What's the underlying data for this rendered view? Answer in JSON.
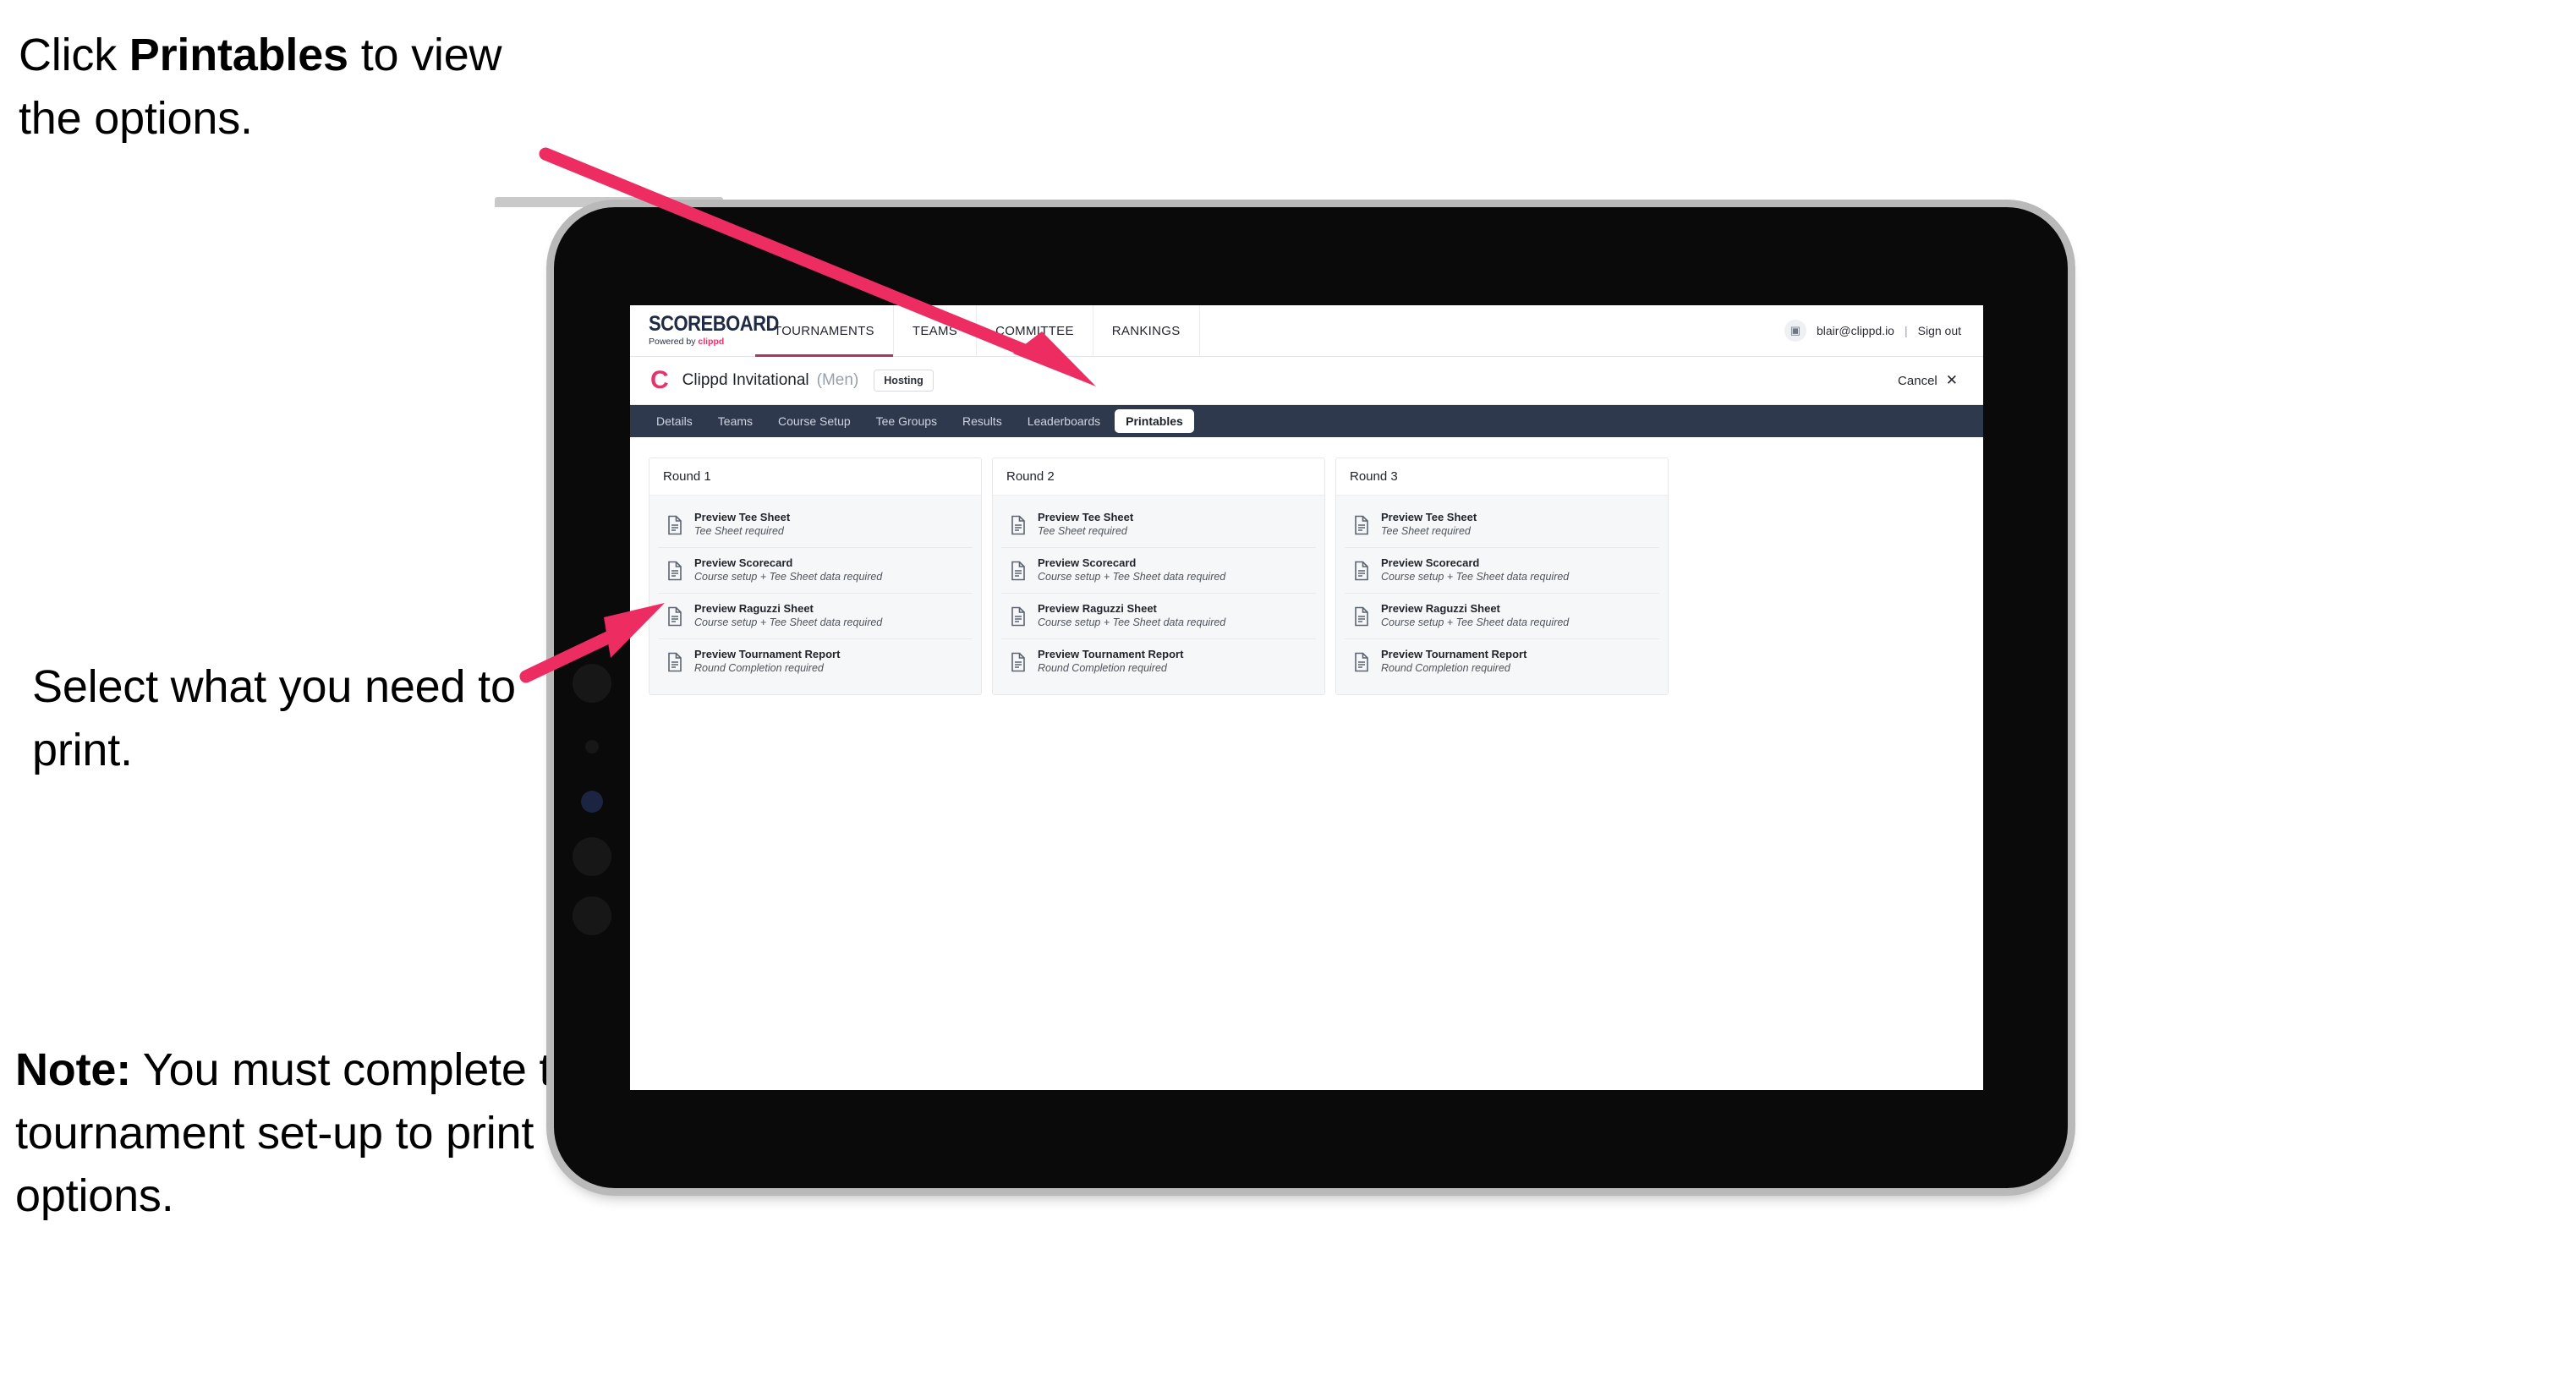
{
  "annotations": [
    {
      "id": "a1",
      "prefix": "Click ",
      "strong": "Printables",
      "suffix": " to view the options."
    },
    {
      "id": "a2",
      "prefix": "",
      "strong": "",
      "suffix": "Select what you need to print."
    },
    {
      "id": "a3",
      "prefix": "",
      "strong": "Note:",
      "suffix": " You must complete the tournament set-up to print all the options."
    }
  ],
  "colors": {
    "arrow_pink": "#ED2D62",
    "brand_pink": "#E6336A",
    "tabbar_navy": "#2F394D",
    "bezel_black": "#0A0A0A",
    "bezel_edge": "#B9B9B9",
    "active_underline": "#B0335C"
  },
  "app": {
    "brand": {
      "title": "SCOREBOARD",
      "powered_prefix": "Powered by ",
      "powered_brand": "clippd"
    },
    "global_nav": [
      {
        "label": "TOURNAMENTS",
        "active": true
      },
      {
        "label": "TEAMS",
        "active": false
      },
      {
        "label": "COMMITTEE",
        "active": false
      },
      {
        "label": "RANKINGS",
        "active": false
      }
    ],
    "account": {
      "avatar_glyph": "▣",
      "email": "blair@clippd.io",
      "separator": "|",
      "sign_out": "Sign out"
    },
    "tournament": {
      "logo_letter": "C",
      "name": "Clippd Invitational",
      "gender": "(Men)",
      "status_badge": "Hosting",
      "cancel_label": "Cancel",
      "cancel_x": "✕"
    },
    "tabs": [
      {
        "label": "Details",
        "active": false
      },
      {
        "label": "Teams",
        "active": false
      },
      {
        "label": "Course Setup",
        "active": false
      },
      {
        "label": "Tee Groups",
        "active": false
      },
      {
        "label": "Results",
        "active": false
      },
      {
        "label": "Leaderboards",
        "active": false
      },
      {
        "label": "Printables",
        "active": true
      }
    ],
    "rounds": [
      {
        "title": "Round 1",
        "items": [
          {
            "title": "Preview Tee Sheet",
            "requirement": "Tee Sheet required"
          },
          {
            "title": "Preview Scorecard",
            "requirement": "Course setup + Tee Sheet data required"
          },
          {
            "title": "Preview Raguzzi Sheet",
            "requirement": "Course setup + Tee Sheet data required"
          },
          {
            "title": "Preview Tournament Report",
            "requirement": "Round Completion required"
          }
        ]
      },
      {
        "title": "Round 2",
        "items": [
          {
            "title": "Preview Tee Sheet",
            "requirement": "Tee Sheet required"
          },
          {
            "title": "Preview Scorecard",
            "requirement": "Course setup + Tee Sheet data required"
          },
          {
            "title": "Preview Raguzzi Sheet",
            "requirement": "Course setup + Tee Sheet data required"
          },
          {
            "title": "Preview Tournament Report",
            "requirement": "Round Completion required"
          }
        ]
      },
      {
        "title": "Round 3",
        "items": [
          {
            "title": "Preview Tee Sheet",
            "requirement": "Tee Sheet required"
          },
          {
            "title": "Preview Scorecard",
            "requirement": "Course setup + Tee Sheet data required"
          },
          {
            "title": "Preview Raguzzi Sheet",
            "requirement": "Course setup + Tee Sheet data required"
          },
          {
            "title": "Preview Tournament Report",
            "requirement": "Round Completion required"
          }
        ]
      }
    ]
  }
}
